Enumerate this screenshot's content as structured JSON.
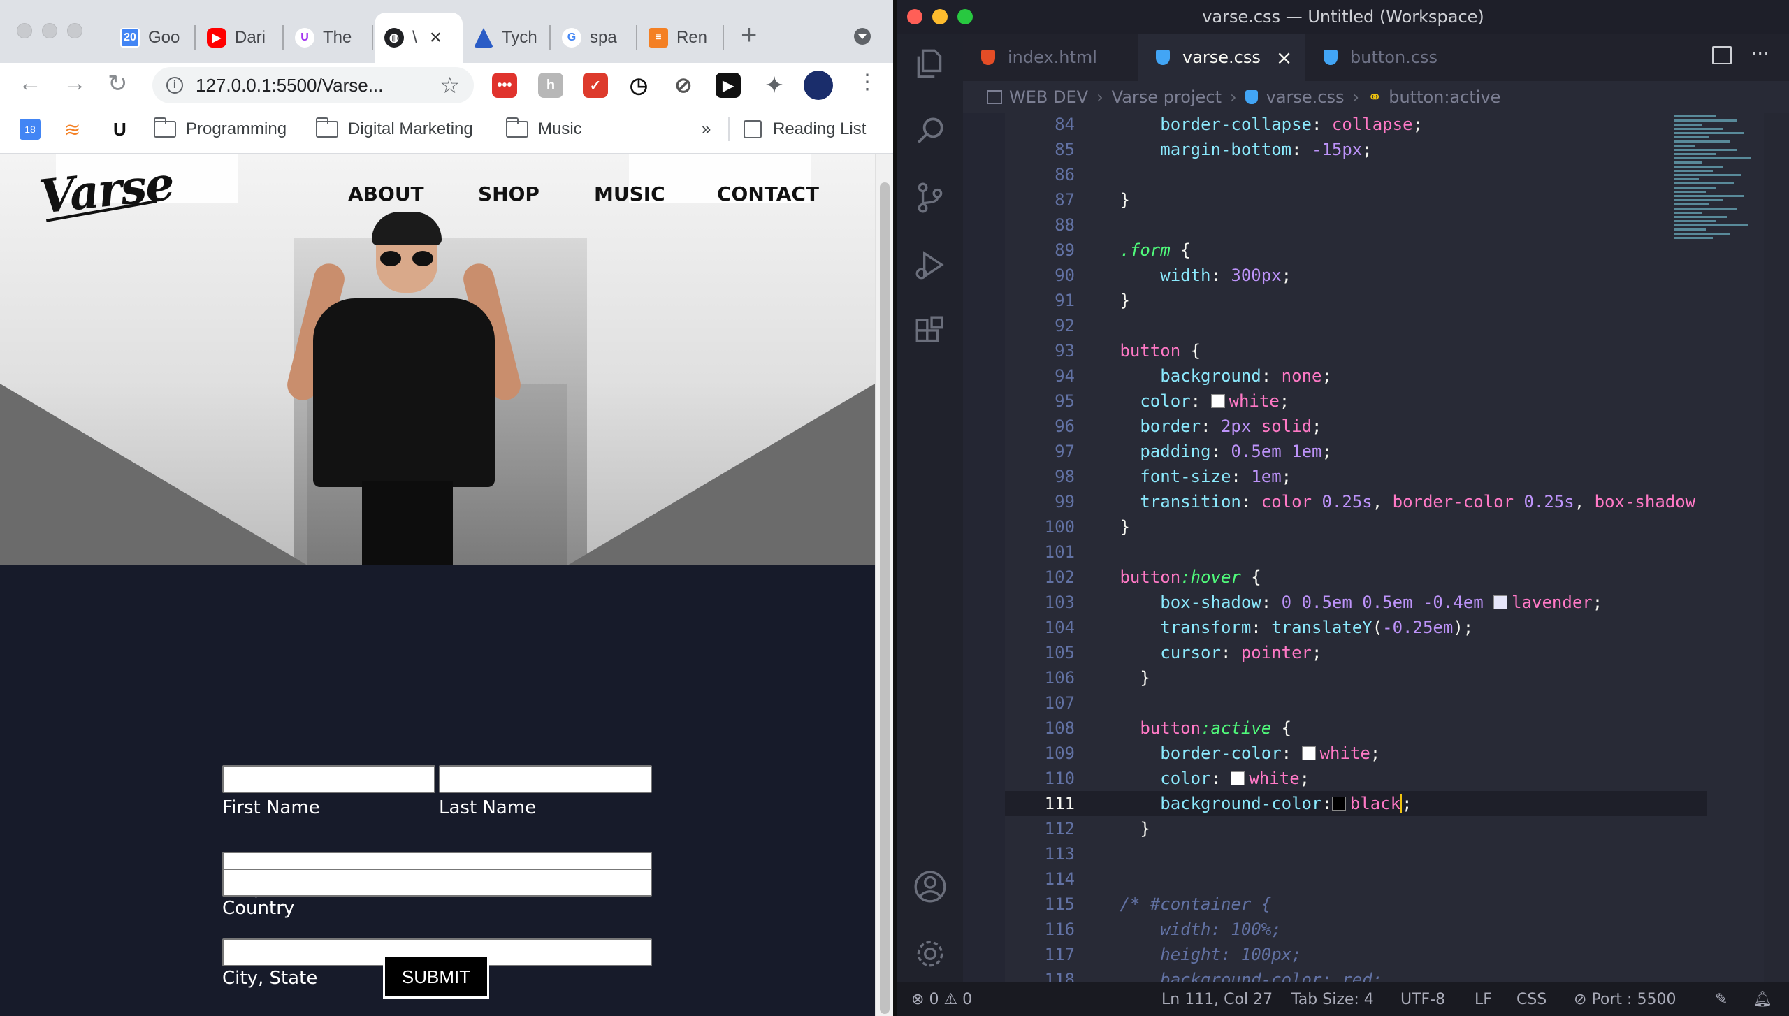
{
  "browser": {
    "tabs": [
      {
        "label": "Goo",
        "icon": "calendar-icon",
        "color": "#4285f4",
        "active": false
      },
      {
        "label": "Dari",
        "icon": "youtube-icon",
        "color": "#ff0000",
        "active": false
      },
      {
        "label": "The",
        "icon": "udemy-icon",
        "color": "#ffffff",
        "active": false
      },
      {
        "label": "\\",
        "icon": "globe-icon",
        "color": "#202124",
        "active": true
      },
      {
        "label": "Tych",
        "icon": "triangle-icon",
        "color": "#2a5cc6",
        "active": false
      },
      {
        "label": "spa",
        "icon": "google-icon",
        "color": "#ffffff",
        "active": false
      },
      {
        "label": "Ren",
        "icon": "stackoverflow-icon",
        "color": "#f48024",
        "active": false
      }
    ],
    "address": "127.0.0.1:5500/Varse...",
    "bookmarks": [
      {
        "label": "",
        "icon": "calendar-icon"
      },
      {
        "label": "",
        "icon": "stack-icon"
      },
      {
        "label": "",
        "icon": "udemy-icon"
      },
      {
        "label": "Programming",
        "icon": "folder-icon"
      },
      {
        "label": "Digital Marketing",
        "icon": "folder-icon"
      },
      {
        "label": "Music",
        "icon": "folder-icon"
      }
    ],
    "more_bookmarks": "»",
    "reading_list": "Reading List",
    "site": {
      "logo": "Varse",
      "nav": [
        "ABOUT",
        "SHOP",
        "MUSIC",
        "CONTACT"
      ],
      "form": {
        "first_name": "First Name",
        "last_name": "Last Name",
        "email": "Email",
        "city_state": "City, State",
        "country": "Country",
        "submit": "SUBMIT"
      }
    }
  },
  "vscode": {
    "title": "varse.css — Untitled (Workspace)",
    "tabs": [
      {
        "label": "index.html",
        "color": "#e44d26",
        "active": false
      },
      {
        "label": "varse.css",
        "color": "#42a5f5",
        "active": true
      },
      {
        "label": "button.css",
        "color": "#42a5f5",
        "active": false
      }
    ],
    "breadcrumb": [
      "WEB DEV",
      "Varse project",
      "varse.css",
      "button:active"
    ],
    "status": {
      "errors": "0",
      "warnings": "0",
      "position": "Ln 111, Col 27",
      "tab_size": "Tab Size: 4",
      "encoding": "UTF-8",
      "eol": "LF",
      "language": "CSS",
      "port": "Port : 5500"
    }
  }
}
